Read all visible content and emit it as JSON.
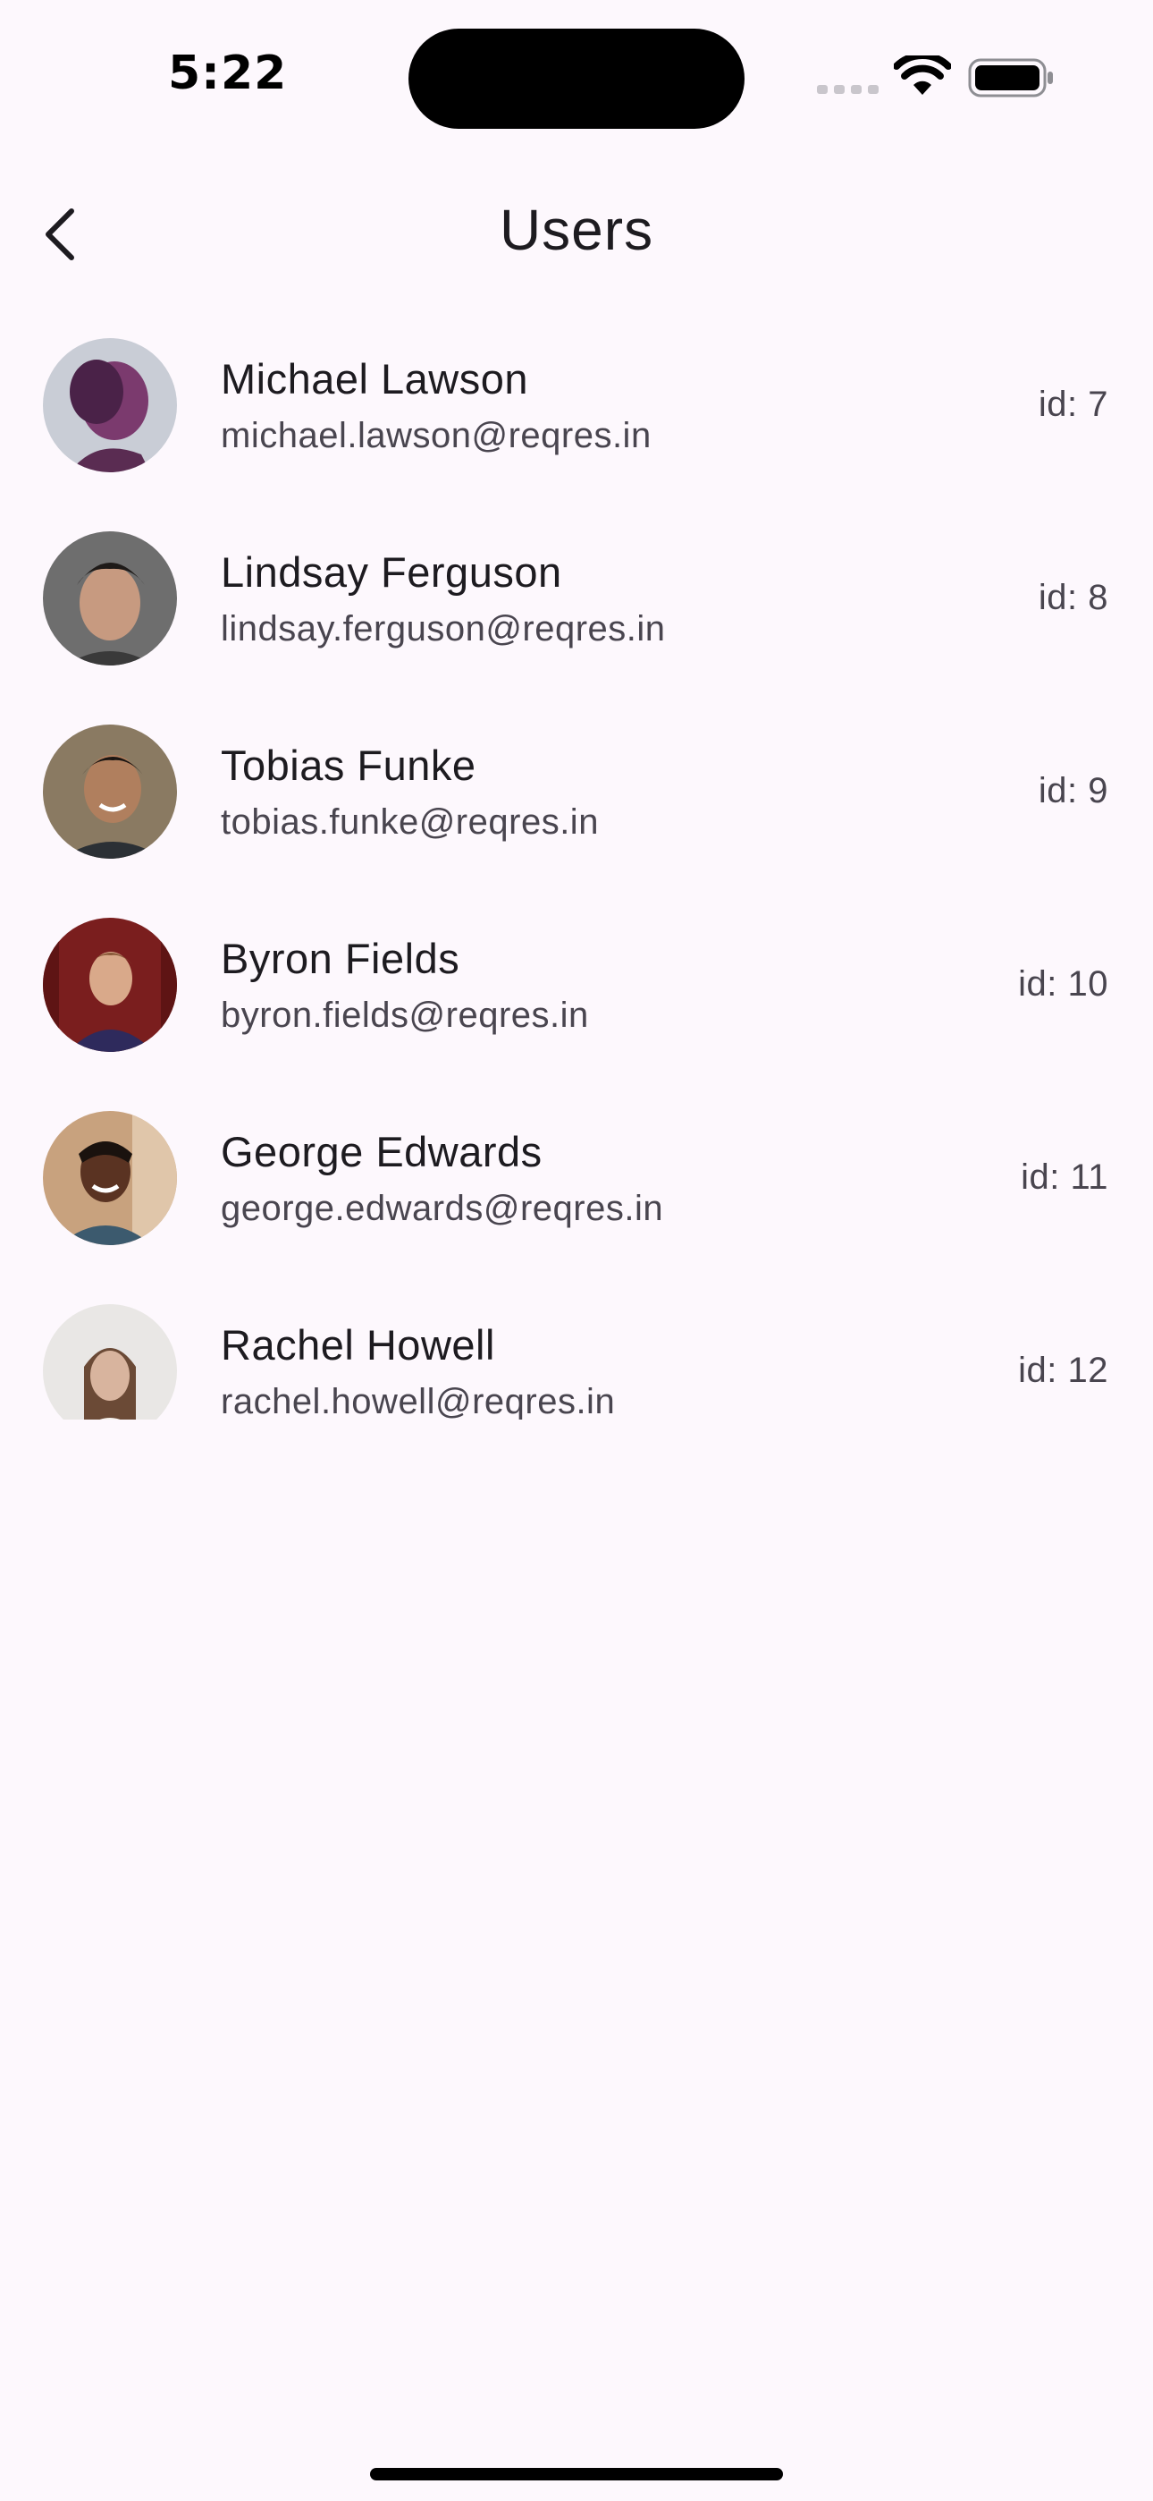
{
  "status_bar": {
    "time": "5:22",
    "icons": [
      "signal-icon",
      "wifi-icon",
      "battery-icon"
    ]
  },
  "app_bar": {
    "title": "Users",
    "back_icon": "chevron-left-icon"
  },
  "users": [
    {
      "name": "Michael Lawson",
      "email": "michael.lawson@reqres.in",
      "id_label": "id: 7",
      "avatar_colors": [
        "#c9cdd6",
        "#7b3a6e",
        "#4a2248"
      ]
    },
    {
      "name": "Lindsay Ferguson",
      "email": "lindsay.ferguson@reqres.in",
      "id_label": "id: 8",
      "avatar_colors": [
        "#6e6e6e",
        "#c79a80",
        "#1e1a18"
      ]
    },
    {
      "name": "Tobias Funke",
      "email": "tobias.funke@reqres.in",
      "id_label": "id: 9",
      "avatar_colors": [
        "#8a7a62",
        "#b07f5e",
        "#2b3035"
      ]
    },
    {
      "name": "Byron Fields",
      "email": "byron.fields@reqres.in",
      "id_label": "id: 10",
      "avatar_colors": [
        "#7a1e1e",
        "#d9a98a",
        "#2e2a5c"
      ]
    },
    {
      "name": "George Edwards",
      "email": "george.edwards@reqres.in",
      "id_label": "id: 11",
      "avatar_colors": [
        "#c8a27e",
        "#5a3322",
        "#3c5a6e"
      ]
    },
    {
      "name": "Rachel Howell",
      "email": "rachel.howell@reqres.in",
      "id_label": "id: 12",
      "avatar_colors": [
        "#e9e7e5",
        "#d8b49e",
        "#f3efe9"
      ]
    }
  ],
  "theme": {
    "background": "#fdf8fd",
    "text_primary": "#1d1b20",
    "text_secondary": "#49454f"
  }
}
